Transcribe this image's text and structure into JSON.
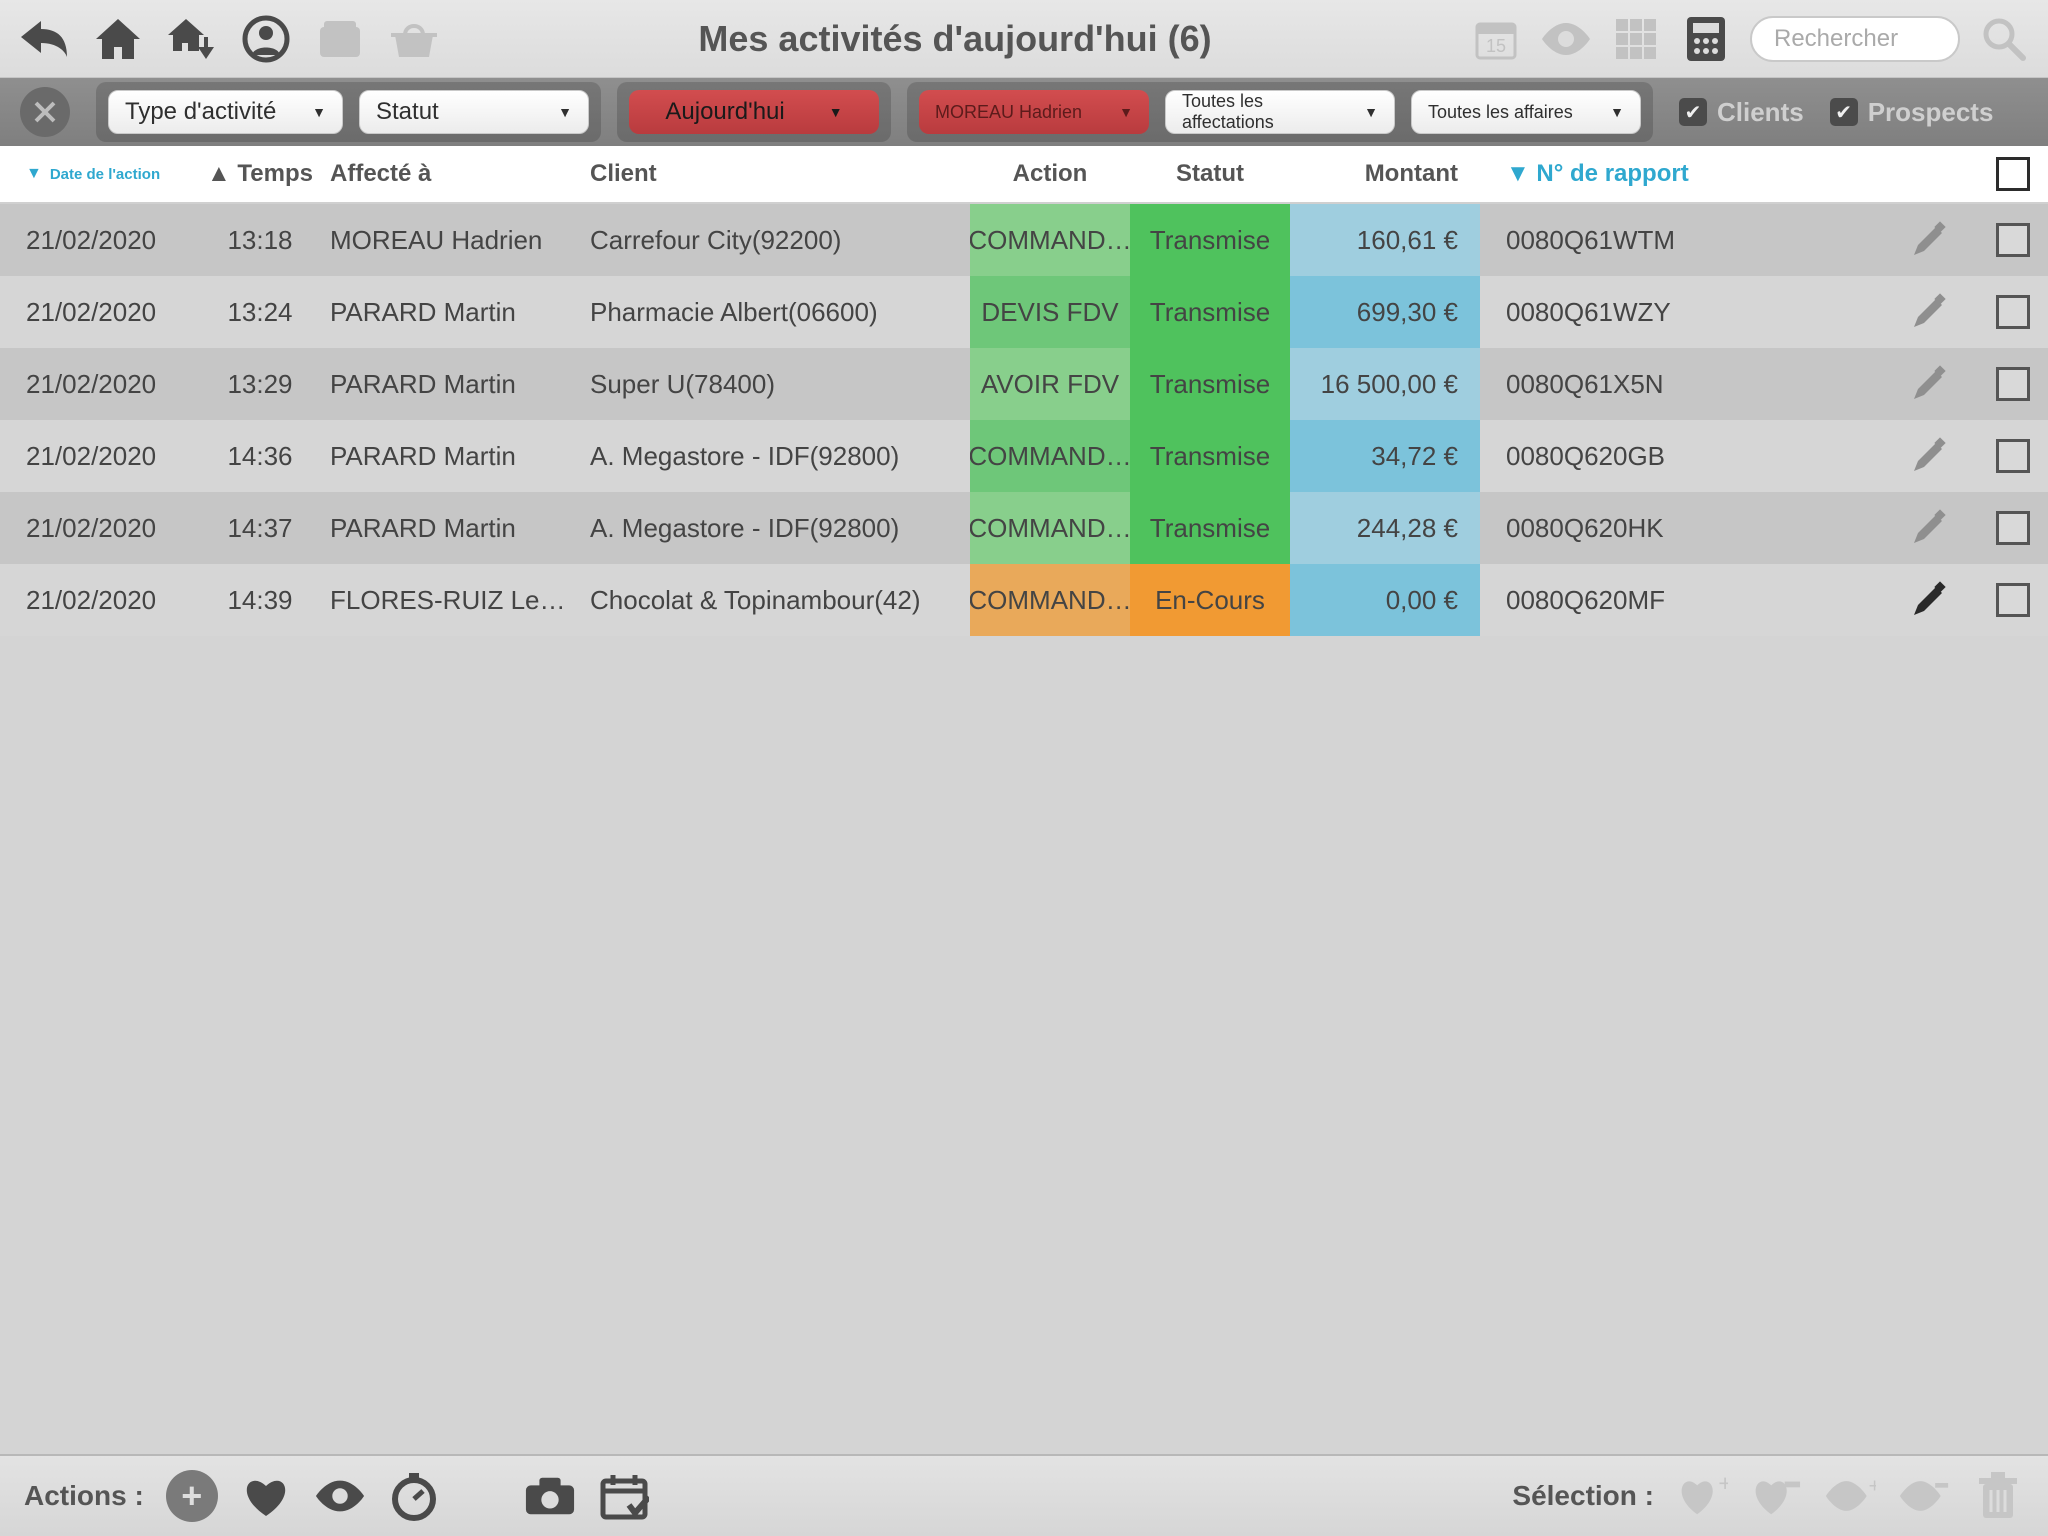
{
  "header": {
    "title": "Mes activités d'aujourd'hui (6)",
    "search_placeholder": "Rechercher"
  },
  "filters": {
    "type_activity": "Type d'activité",
    "status": "Statut",
    "today": "Aujourd'hui",
    "person": "MOREAU Hadrien",
    "assignments": "Toutes les affectations",
    "affairs": "Toutes les affaires",
    "check_clients": "Clients",
    "check_prospects": "Prospects"
  },
  "columns": {
    "date": "Date de l'action",
    "time": "Temps",
    "assigned": "Affecté à",
    "client": "Client",
    "action": "Action",
    "status": "Statut",
    "amount": "Montant",
    "report": "N° de rapport"
  },
  "rows": [
    {
      "date": "21/02/2020",
      "time": "13:18",
      "assigned": "MOREAU Hadrien",
      "client": "Carrefour City(92200)",
      "action": "COMMAND…",
      "action_class": "ac-green",
      "status": "Transmise",
      "status_class": "ac-dgreen",
      "amount": "160,61 €",
      "amount_class": "ac-blue",
      "report": "0080Q61WTM",
      "pencil_dark": false
    },
    {
      "date": "21/02/2020",
      "time": "13:24",
      "assigned": "PARARD Martin",
      "client": "Pharmacie Albert(06600)",
      "action": "DEVIS FDV",
      "action_class": "ac-green2",
      "status": "Transmise",
      "status_class": "ac-dgreen",
      "amount": "699,30 €",
      "amount_class": "ac-blue2",
      "report": "0080Q61WZY",
      "pencil_dark": false
    },
    {
      "date": "21/02/2020",
      "time": "13:29",
      "assigned": "PARARD Martin",
      "client": "Super U(78400)",
      "action": "AVOIR FDV",
      "action_class": "ac-green",
      "status": "Transmise",
      "status_class": "ac-dgreen",
      "amount": "16 500,00 €",
      "amount_class": "ac-blue",
      "report": "0080Q61X5N",
      "pencil_dark": false
    },
    {
      "date": "21/02/2020",
      "time": "14:36",
      "assigned": "PARARD Martin",
      "client": "A. Megastore - IDF(92800)",
      "action": "COMMAND…",
      "action_class": "ac-green2",
      "status": "Transmise",
      "status_class": "ac-dgreen",
      "amount": "34,72 €",
      "amount_class": "ac-blue2",
      "report": "0080Q620GB",
      "pencil_dark": false
    },
    {
      "date": "21/02/2020",
      "time": "14:37",
      "assigned": "PARARD Martin",
      "client": "A. Megastore - IDF(92800)",
      "action": "COMMAND…",
      "action_class": "ac-green",
      "status": "Transmise",
      "status_class": "ac-dgreen",
      "amount": "244,28 €",
      "amount_class": "ac-blue",
      "report": "0080Q620HK",
      "pencil_dark": false
    },
    {
      "date": "21/02/2020",
      "time": "14:39",
      "assigned": "FLORES-RUIZ Le…",
      "client": "Chocolat & Topinambour(42)",
      "action": "COMMAND…",
      "action_class": "ac-orange",
      "status": "En-Cours",
      "status_class": "ac-orange2",
      "amount": "0,00 €",
      "amount_class": "ac-blue2",
      "report": "0080Q620MF",
      "pencil_dark": true
    }
  ],
  "footer": {
    "actions_label": "Actions :",
    "selection_label": "Sélection :"
  }
}
